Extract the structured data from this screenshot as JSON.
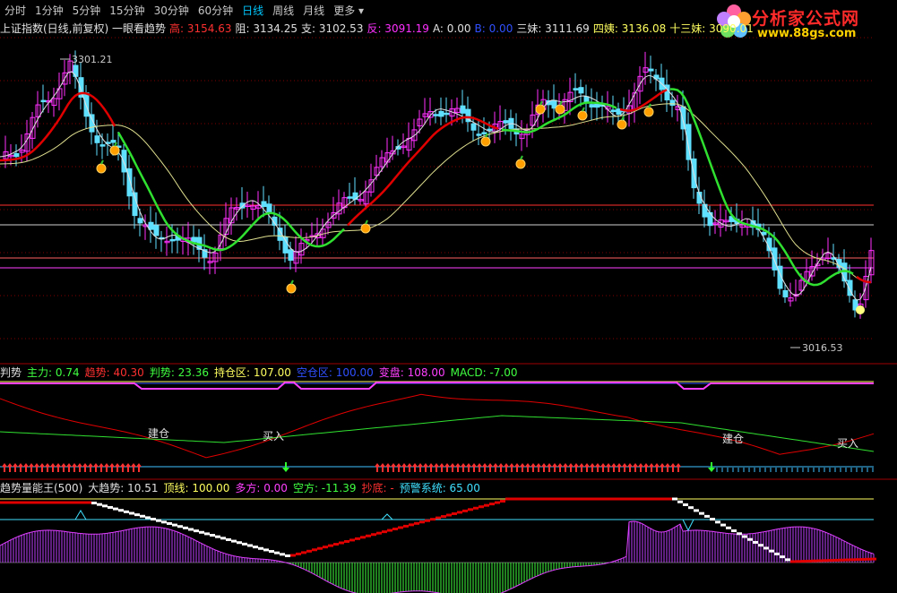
{
  "tabs": [
    {
      "label": "分时",
      "active": false
    },
    {
      "label": "1分钟",
      "active": false
    },
    {
      "label": "5分钟",
      "active": false
    },
    {
      "label": "15分钟",
      "active": false
    },
    {
      "label": "30分钟",
      "active": false
    },
    {
      "label": "60分钟",
      "active": false
    },
    {
      "label": "日线",
      "active": true
    },
    {
      "label": "周线",
      "active": false
    },
    {
      "label": "月线",
      "active": false
    },
    {
      "label": "更多 ▾",
      "active": false
    }
  ],
  "logo": {
    "title": "分析家公式网",
    "url": "www.88gs.com"
  },
  "main_info": {
    "name": "上证指数(日线,前复权) 一眼看趋势",
    "items": [
      {
        "label": "高:",
        "value": "3154.63",
        "color": "#ff3030"
      },
      {
        "label": "阻:",
        "value": "3134.25",
        "color": "#e0e0e0"
      },
      {
        "label": "支:",
        "value": "3102.53",
        "color": "#e0e0e0"
      },
      {
        "label": "反:",
        "value": "3091.19",
        "color": "#ff30ff"
      },
      {
        "label": "A:",
        "value": "0.00",
        "color": "#e0e0e0"
      },
      {
        "label": "B:",
        "value": "0.00",
        "color": "#3050ff"
      },
      {
        "label": "三妹:",
        "value": "3111.69",
        "color": "#e0e0e0"
      },
      {
        "label": "四姨:",
        "value": "3136.08",
        "color": "#ffff60"
      },
      {
        "label": "十三妹:",
        "value": "3090.01",
        "color": "#ffff60"
      }
    ]
  },
  "price_labels": {
    "high": "3301.21",
    "low": "3016.53"
  },
  "ind1_info": {
    "name": "判势",
    "items": [
      {
        "label": "主力:",
        "value": "0.74",
        "color": "#40ff40"
      },
      {
        "label": "趋势:",
        "value": "40.30",
        "color": "#ff3030"
      },
      {
        "label": "判势:",
        "value": "23.36",
        "color": "#40ff40"
      },
      {
        "label": "持仓区:",
        "value": "107.00",
        "color": "#ffff60"
      },
      {
        "label": "空仓区:",
        "value": "100.00",
        "color": "#3050ff"
      },
      {
        "label": "变盘:",
        "value": "108.00",
        "color": "#ff40ff"
      },
      {
        "label": "MACD:",
        "value": "-7.00",
        "color": "#40ff40"
      }
    ],
    "annotations": [
      {
        "text": "建仓"
      },
      {
        "text": "买入"
      },
      {
        "text": "建仓"
      },
      {
        "text": "买入"
      }
    ]
  },
  "ind2_info": {
    "name": "趋势量能王(500)",
    "items": [
      {
        "label": "大趋势:",
        "value": "10.51",
        "color": "#e0e0e0"
      },
      {
        "label": "顶线:",
        "value": "100.00",
        "color": "#ffff60"
      },
      {
        "label": "多方:",
        "value": "0.00",
        "color": "#ff40ff"
      },
      {
        "label": "空方:",
        "value": "-11.39",
        "color": "#40ff40"
      },
      {
        "label": "抄底:",
        "value": "-",
        "color": "#ff3030"
      },
      {
        "label": "预警系统:",
        "value": "65.00",
        "color": "#40e0ff"
      }
    ]
  },
  "colors": {
    "up": "#ff30ff",
    "down": "#60e0ff",
    "ma_fast": "#e0e0e0",
    "ma_red": "#e00000",
    "ma_green": "#30e030",
    "ma_yellow": "#e0e090"
  }
}
